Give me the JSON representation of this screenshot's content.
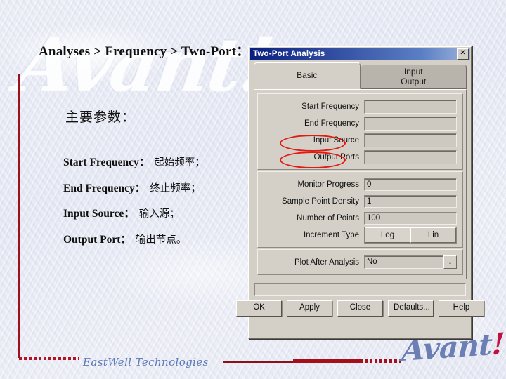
{
  "slide": {
    "heading": "Analyses > Frequency > Two-Port：",
    "watermark": "Avant!",
    "section_title": "主要参数：",
    "params": [
      "Start Frequency：",
      "End Frequency：",
      "Input Source：",
      "Output Port："
    ],
    "params_cn": [
      "起始频率；",
      "终止频率；",
      "输入源；",
      "输出节点。"
    ],
    "footer_brand": "EastWell Technologies",
    "logo_text": "Avant",
    "logo_bang": "!",
    "accent_red": "#a50f1b",
    "brand_blue": "#5b78b8"
  },
  "dialog": {
    "title": "Two-Port Analysis",
    "close_label": "✕",
    "tabs": [
      {
        "label": "Basic",
        "active": true
      },
      {
        "label_line1": "Input",
        "label_line2": "Output",
        "active": false
      }
    ],
    "fields": [
      {
        "label": "Start Frequency",
        "value": "",
        "circled": false
      },
      {
        "label": "End Frequency",
        "value": "",
        "circled": false
      },
      {
        "label": "Input Source",
        "value": "",
        "circled": true
      },
      {
        "label": "Output Ports",
        "value": "",
        "circled": true
      }
    ],
    "fields2": [
      {
        "label": "Monitor Progress",
        "value": "0"
      },
      {
        "label": "Sample Point Density",
        "value": "1"
      },
      {
        "label": "Number of Points",
        "value": "100"
      }
    ],
    "increment": {
      "label": "Increment Type",
      "options": [
        "Log",
        "Lin"
      ],
      "selected": "Log"
    },
    "plot": {
      "label": "Plot After Analysis",
      "value": "No",
      "arrow": "↓"
    },
    "buttons": [
      "OK",
      "Apply",
      "Close",
      "Defaults...",
      "Help"
    ]
  }
}
